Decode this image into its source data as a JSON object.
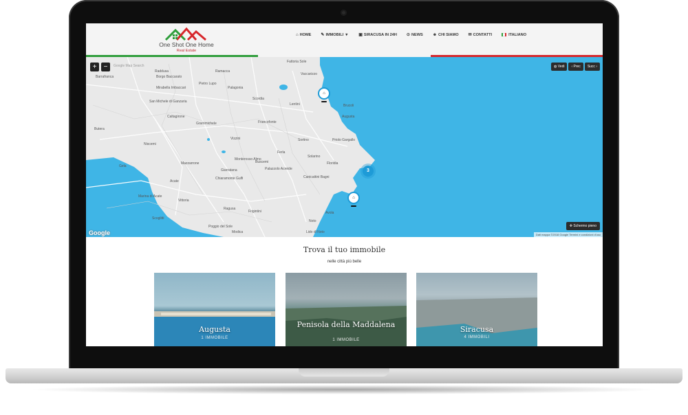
{
  "header": {
    "logo_title": "One Shot One Home",
    "logo_subtitle": "Real Estate",
    "nav": [
      {
        "icon": "home-icon",
        "glyph": "⌂",
        "label": "HOME"
      },
      {
        "icon": "wrench-icon",
        "glyph": "✎",
        "label": "IMMOBILI"
      },
      {
        "icon": "calendar-icon",
        "glyph": "▣",
        "label": "SIRACUSA IN 24H"
      },
      {
        "icon": "rss-icon",
        "glyph": "⊙",
        "label": "NEWS"
      },
      {
        "icon": "users-icon",
        "glyph": "☻",
        "label": "CHI SIAMO"
      },
      {
        "icon": "envelope-icon",
        "glyph": "✉",
        "label": "CONTATTI"
      },
      {
        "icon": "italy-flag-icon",
        "glyph": "",
        "label": "ITALIANO"
      }
    ],
    "flag_colors": [
      "#2e9d3a",
      "#ffffff",
      "#d7262b"
    ]
  },
  "map": {
    "zoom_in": "+",
    "zoom_out": "−",
    "search_hint": "Google Map Search",
    "controls": {
      "view": "Vedi",
      "prev": "Prec",
      "next": "Succ"
    },
    "fullscreen": "Schermo pieno",
    "google": "Google",
    "footer": "Dati mappa ©2018 Google   Termini e condizioni d'uso",
    "cluster_count": "3",
    "sea_color": "#3fb5e6",
    "places": [
      "Barrafranca",
      "Ramacca",
      "Fattoria Sole",
      "Raddusa",
      "Borgo Baccarato",
      "Pietro Lupo",
      "Palagonia",
      "Vaccarizzo",
      "Mirabella Imbaccari",
      "San Michele di Ganzaria",
      "Scordia",
      "Lentini",
      "Brucoli",
      "Augusta",
      "Caltagirone",
      "Grammichele",
      "Francofonte",
      "Vizzini",
      "Sortino",
      "Priolo Gargallo",
      "Butera",
      "Niscemi",
      "Ferla",
      "Solarino",
      "Floridia",
      "Gela",
      "Mazzarrone",
      "Monterosso Almo",
      "Buscemi",
      "Palazzolo Acreide",
      "Canicattini Bagni",
      "Acate",
      "Chiaramonte Gulfi",
      "Giarratana",
      "Vittoria",
      "Ragusa",
      "Frigintini",
      "Scoglitti",
      "Poggio del Sole",
      "Modica",
      "Noto",
      "Avola",
      "Lido di Noto",
      "Marina di Acate"
    ]
  },
  "section": {
    "title": "Trova il tuo immobile",
    "subtitle": "nelle città più belle"
  },
  "cities": [
    {
      "name": "Augusta",
      "count": "1 IMMOBILE"
    },
    {
      "name": "Penisola della Maddalena",
      "count": "1 IMMOBILE"
    },
    {
      "name": "Siracusa",
      "count": "4 IMMOBILI"
    }
  ]
}
